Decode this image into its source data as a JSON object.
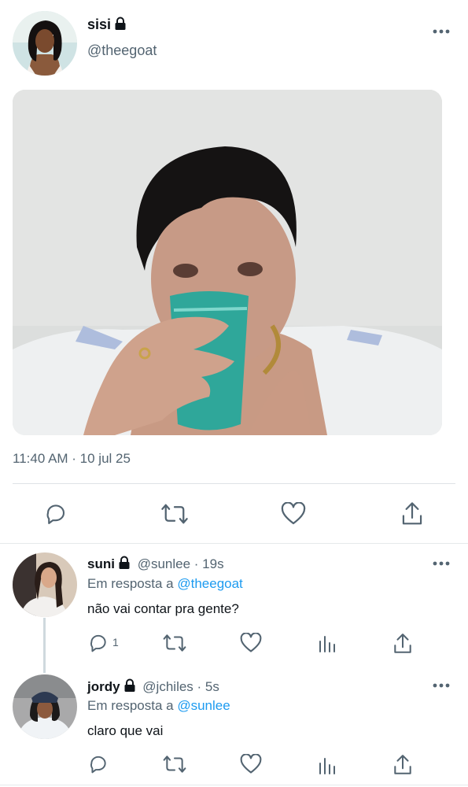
{
  "tweet": {
    "display_name": "sisi",
    "handle": "@theegoat",
    "protected_icon": "lock-icon",
    "media_description": "photo",
    "timestamp": "11:40 AM · 10 jul 25",
    "actions": {
      "reply_icon": "reply-icon",
      "retweet_icon": "retweet-icon",
      "like_icon": "heart-icon",
      "share_icon": "share-icon"
    }
  },
  "replies": [
    {
      "display_name": "suni",
      "handle": "@sunlee",
      "time": "· 19s",
      "reply_prefix": "Em resposta a",
      "reply_target": "@theegoat",
      "text": "não vai contar pra gente?",
      "reply_count": "1"
    },
    {
      "display_name": "jordy",
      "handle": "@jchiles",
      "time": "· 5s",
      "reply_prefix": "Em resposta a",
      "reply_target": "@sunlee",
      "text": "claro que vai"
    }
  ],
  "colors": {
    "accent": "#1d9bf0",
    "muted": "#536471",
    "icon": "#536471"
  }
}
